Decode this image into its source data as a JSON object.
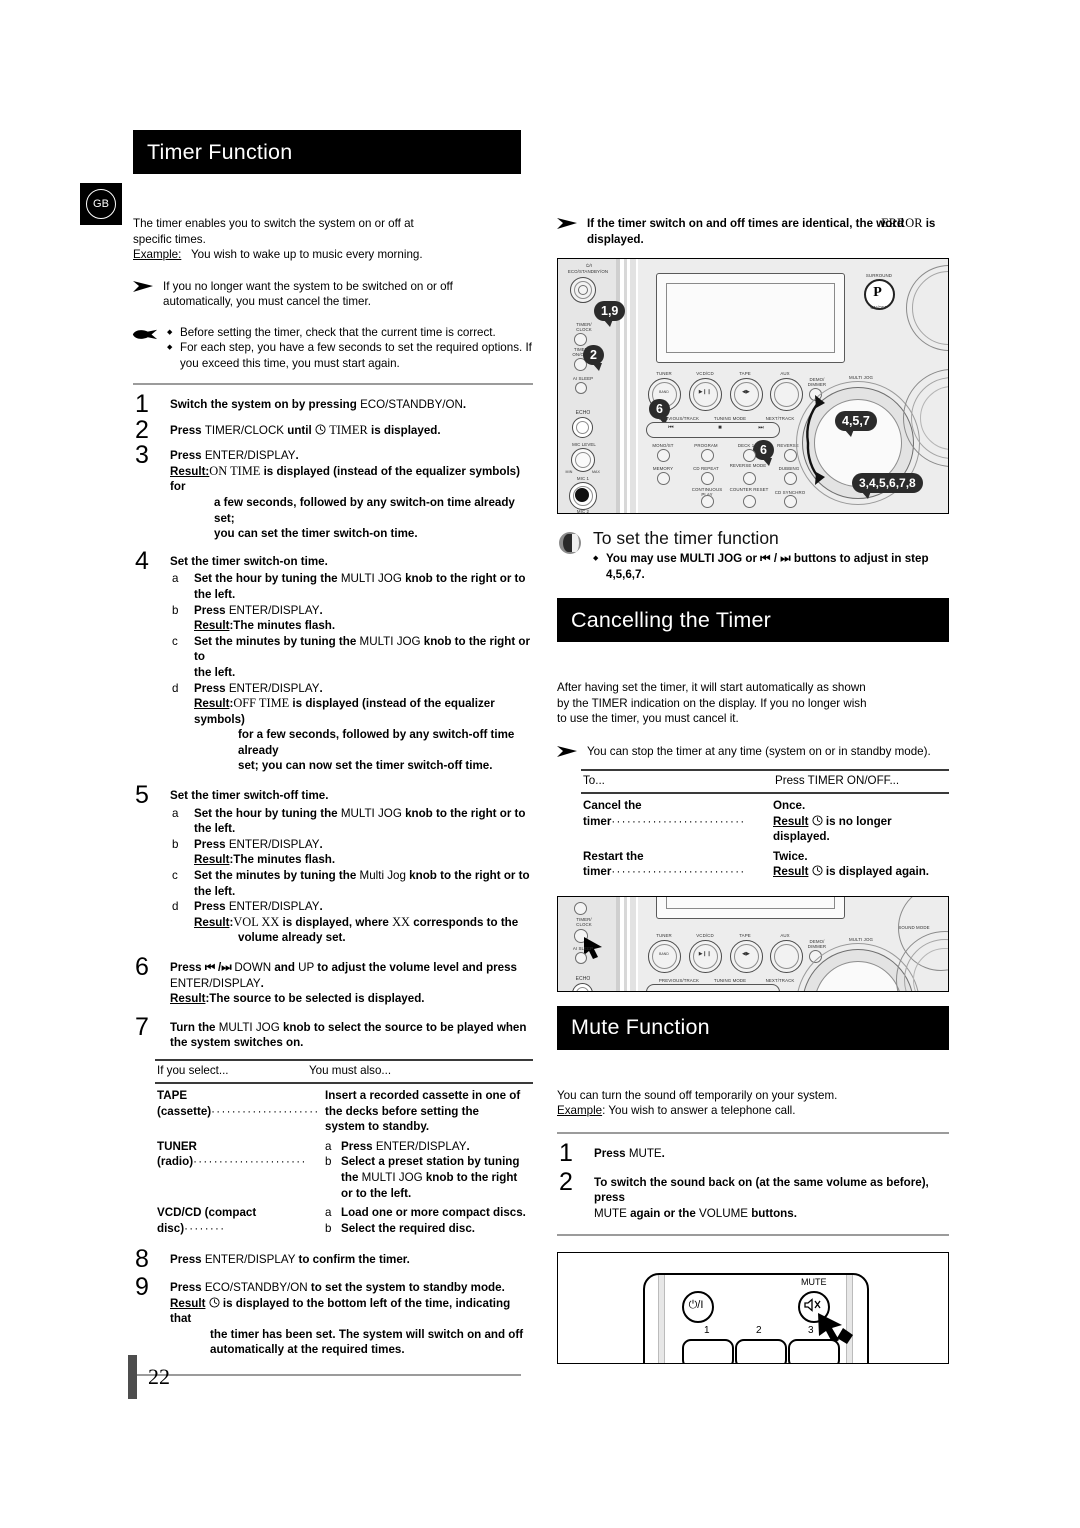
{
  "locale_badge": "GB",
  "page_number": "22",
  "left": {
    "heading": "Timer Function",
    "intro_line1": "The timer enables you to switch the system on or off at",
    "intro_line2": "specific times.",
    "example_label": "Example:",
    "example_text": "You wish to wake up to music every morning.",
    "note_arrow_line1": "If you no longer want the system to be switched on or off",
    "note_arrow_line2": "automatically, you must cancel the timer.",
    "hand_bullets": [
      "Before setting the timer, check that the current time is correct.",
      "For each step, you have a few seconds to set the required options. If you exceed this time, you must start again."
    ],
    "steps": [
      {
        "n": "1",
        "lines": [
          {
            "parts": [
              {
                "t": "Switch the system on by pressing ",
                "b": true
              },
              {
                "t": "ECO/STANDBY/ON",
                "b": false
              },
              {
                "t": ".",
                "b": true
              }
            ]
          }
        ]
      },
      {
        "n": "2",
        "lines": [
          {
            "parts": [
              {
                "t": "Press ",
                "b": true
              },
              {
                "t": "TIMER/CLOCK ",
                "b": false
              },
              {
                "t": "until ",
                "b": true
              },
              {
                "t": "\u0001clock ",
                "b": false
              },
              {
                "t": "TIMER",
                "b": false,
                "serif": true
              },
              {
                "t": " is displayed.",
                "b": true
              }
            ]
          }
        ]
      },
      {
        "n": "3",
        "lines": [
          {
            "parts": [
              {
                "t": "Press ",
                "b": true
              },
              {
                "t": "ENTER/DISPLAY",
                "b": false
              },
              {
                "t": ".",
                "b": true
              }
            ]
          }
        ],
        "result_label": "Result:",
        "result": "ON TIME is displayed (instead of the equalizer symbols) for a few seconds, followed by any switch-on time already set; you can set the timer switch-on time.",
        "result_sc": "ON TIME"
      },
      {
        "n": "4",
        "title": "Set the timer switch-on time.",
        "subs": [
          {
            "l": "a",
            "text": "Set the hour by tuning the MULTI JOG knob to the right or to the left."
          },
          {
            "l": "b",
            "text": "Press ENTER/DISPLAY.",
            "result_label": "Result:",
            "result": "The minutes flash."
          },
          {
            "l": "c",
            "text": "Set the minutes by tuning the MULTI JOG knob to the right or to the left."
          },
          {
            "l": "d",
            "text": "Press ENTER/DISPLAY.",
            "result_label": "Result:",
            "result": "OFF TIME is displayed (instead of the equalizer symbols) for a few seconds, followed by any switch-off time already set; you can now set the timer switch-off time.",
            "result_sc": "OFF TIME"
          }
        ]
      },
      {
        "n": "5",
        "title": "Set the timer switch-off time.",
        "subs": [
          {
            "l": "a",
            "text": "Set the hour by tuning the MULTI JOG knob to the right or to the left."
          },
          {
            "l": "b",
            "text": "Press ENTER/DISPLAY.",
            "result_label": "Result:",
            "result": "The minutes flash."
          },
          {
            "l": "c",
            "text": "Set the minutes by tuning the Multi Jog knob to the right or to the left."
          },
          {
            "l": "d",
            "text": "Press ENTER/DISPLAY.",
            "result_label": "Result:",
            "result": "VOL XX is displayed, where XX corresponds to the volume already set.",
            "result_sc": "VOL XX"
          }
        ]
      },
      {
        "n": "6",
        "text": "Press ⏮ / ⏭ DOWN and UP to adjust the volume level and press ENTER/DISPLAY.",
        "result_label": "Result:",
        "result": "The source to be selected is displayed."
      },
      {
        "n": "7",
        "text": "Turn the MULTI JOG knob to select the source to be played when the system switches on."
      },
      {
        "n": "8",
        "text": "Press ENTER/DISPLAY to confirm the timer."
      },
      {
        "n": "9",
        "text": "Press ECO/STANDBY/ON to set the system to standby mode.",
        "result_label": "Result",
        "result": "\u0001clock is displayed to the bottom left of the time, indicating that the timer has been set. The system will switch on and off automatically at the required times."
      }
    ],
    "source_table": {
      "col1_header": "If you select...",
      "col2_header": "You must also...",
      "rows": [
        {
          "c1": "TAPE (cassette)",
          "c2_lines": [
            "Insert a recorded cassette in one of",
            "the decks before setting the",
            "system to standby."
          ]
        },
        {
          "c1": "TUNER (radio)",
          "subs": [
            {
              "l": "a",
              "t": "Press ENTER/DISPLAY."
            },
            {
              "l": "b",
              "t": "Select a preset station by tuning the MULTI JOG knob to the right or to the left."
            }
          ]
        },
        {
          "c1": "VCD/CD (compact disc)",
          "subs": [
            {
              "l": "a",
              "t": "Load one or more compact discs."
            },
            {
              "l": "b",
              "t": "Select the required disc."
            }
          ]
        }
      ]
    }
  },
  "right": {
    "error_note_line1_a": "If the timer switch on and off times are identical, the word ",
    "error_note_word": "ERROR",
    "error_note_line1_b": " is",
    "error_note_line2": "displayed.",
    "tip_heading": "To set the timer function",
    "tip_bullet_line1": "You may use MULTI JOG or ⏮ / ⏭ buttons to adjust in step",
    "tip_bullet_line2": "4,5,6,7.",
    "cancel_heading": "Cancelling the Timer",
    "cancel_para": [
      "After having set the timer, it will start automatically as shown",
      "by the TIMER indication on the display. If you no longer wish",
      "to use the timer, you must cancel it."
    ],
    "cancel_note": "You can stop the timer at any time (system on or in standby mode).",
    "cancel_table": {
      "col1_header": "To...",
      "col2_header": "Press TIMER ON/OFF...",
      "rows": [
        {
          "c1": "Cancel the timer",
          "c2": "Once.",
          "result_label": "Result",
          "result": "\u0001clock is no longer displayed."
        },
        {
          "c1": "Restart the timer",
          "c2": "Twice.",
          "result_label": "Result",
          "result": "\u0001clock is displayed again."
        }
      ]
    },
    "mute_heading": "Mute Function",
    "mute_para1": "You can turn the sound off temporarily on your system.",
    "mute_example_label": "Example",
    "mute_example_text": ": You wish to answer a telephone call.",
    "mute_steps": [
      {
        "n": "1",
        "text": "Press MUTE."
      },
      {
        "n": "2",
        "text": "To switch the sound back on (at the same volume as before), press MUTE again or the VOLUME buttons."
      }
    ]
  },
  "figure_main": {
    "callouts": [
      "1,9",
      "2",
      "6",
      "6",
      "4,5,7",
      "3,4,5,6,7,8"
    ],
    "left_labels": [
      "⏻/I",
      "ECO/STANDBY/ON",
      "TIMER/",
      "CLOCK",
      "TIMER",
      "ON/OFF",
      "AI SLEEP",
      "ECHO",
      "MIC LEVEL",
      "MIN",
      "MAX",
      "MIC 1",
      "MIC 2"
    ],
    "source_labels": [
      "TUNER",
      "VCD/CD",
      "TAPE",
      "AUX"
    ],
    "tuner_sub": "BAND",
    "demo_label_1": "DEMO/",
    "demo_label_2": "DIMMER",
    "transport_labels": [
      "PREVIOUS/TRACK",
      "TUNING MODE",
      "NEXT/TRACK"
    ],
    "button_grid": [
      "MONO/ST",
      "PROGRAM",
      "DECK 1/2",
      "REVERSE",
      "MEMORY",
      "CD REPEAT",
      "REVERSE MODE",
      "DUBBING",
      "CONTINUOUS PLAY",
      "COUNTER RESET",
      "CD SYNCHRO"
    ],
    "jog_label": "MULTI JOG",
    "p_label_top": "SURROUND",
    "p_label_bottom": "ON/OFF",
    "p_letter": "P"
  },
  "figure_mute": {
    "left_labels": [
      "TIMER/",
      "CLOCK",
      "TIMER",
      "ON/OFF",
      "AI SLEEP",
      "ECHO"
    ],
    "source_labels": [
      "TUNER",
      "VCD/CD",
      "TAPE",
      "AUX"
    ],
    "tuner_sub": "BAND",
    "demo_label_1": "DEMO/",
    "demo_label_2": "DIMMER",
    "transport_labels": [
      "PREVIOUS/TRACK",
      "TUNING MODE",
      "NEXT/TRACK"
    ],
    "jog_label": "MULTI JOG",
    "sound_mode_label": "SOUND MODE"
  },
  "figure_remote": {
    "mute_label": "MUTE",
    "power_glyph": "⏻/I",
    "number_labels": [
      "1",
      "2",
      "3"
    ]
  }
}
